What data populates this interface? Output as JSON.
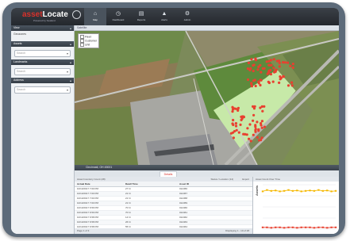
{
  "brand": {
    "name_prefix": "asset",
    "name": "Locate",
    "registered": "®",
    "sub": "Powered by Sealand"
  },
  "nav": [
    {
      "label": "Map",
      "icon": "map-icon",
      "glyph": "⌂"
    },
    {
      "label": "Dashboard",
      "icon": "dashboard-icon",
      "glyph": "◷"
    },
    {
      "label": "Reports",
      "icon": "reports-icon",
      "glyph": "▤"
    },
    {
      "label": "Alerts",
      "icon": "alerts-icon",
      "glyph": "▲"
    },
    {
      "label": "Admin",
      "icon": "admin-icon",
      "glyph": "⚙"
    }
  ],
  "sidebar": {
    "sections": [
      {
        "title": "View",
        "text": "Geozones",
        "input": ""
      },
      {
        "title": "Assets",
        "text": "",
        "input": "Search"
      },
      {
        "title": "Landmarks",
        "text": "",
        "input": "Search"
      },
      {
        "title": "Address",
        "text": "",
        "input": "Search"
      }
    ]
  },
  "map": {
    "header": "Satellite",
    "legend": [
      {
        "label": "Fleet",
        "color": "#ffffff"
      },
      {
        "label": "Customer",
        "color": "#ffffff"
      },
      {
        "label": "Unit",
        "color": "#ffffff"
      }
    ],
    "marker_color": "#e8402f",
    "zone_color": "#c7e9a8"
  },
  "address_bar": "Cincinnati, OH 45001",
  "tabs": {
    "active": "Details"
  },
  "table": {
    "title": "Asset Inventory Count (28)",
    "title_right": "Status / Location (14)",
    "title_export": "Export",
    "headers": [
      "Actual Date",
      "Dwell Time",
      "Asset ID"
    ],
    "rows": [
      [
        "10/13/2017 7:00 PM",
        "27 hr",
        "012456"
      ],
      [
        "10/13/2017 7:00 PM",
        "21 hr",
        "012457"
      ],
      [
        "10/13/2017 7:00 PM",
        "21 hr",
        "012458"
      ],
      [
        "10/13/2017 7:00 PM",
        "21 hr",
        "012459"
      ],
      [
        "10/13/2017 6:59 PM",
        "70 hr",
        "012460"
      ],
      [
        "10/13/2017 6:59 PM",
        "70 hr",
        "012461"
      ],
      [
        "10/13/2017 6:58 PM",
        "14 hr",
        "012462"
      ],
      [
        "10/13/2017 6:58 PM",
        "26 hr",
        "012463"
      ],
      [
        "10/13/2017 6:58 PM",
        "55 hr",
        "012464"
      ]
    ],
    "pager_left": "Page 1 of 3",
    "pager_right": "Displaying 1 - 10 of 28"
  },
  "chart_panel": {
    "title": "Asset Count Over Time",
    "chart_data": {
      "type": "line",
      "title": "",
      "xlabel": "",
      "ylabel": "Assets",
      "series": [
        {
          "name": "",
          "color": "#f5b800",
          "values": [
            85,
            88,
            86,
            87,
            85,
            86,
            88,
            86,
            87,
            85,
            86,
            87,
            86,
            88,
            86,
            87,
            85,
            86
          ]
        },
        {
          "name": "",
          "color": "#e8402f",
          "values": [
            4,
            4,
            3,
            4,
            4,
            3,
            4,
            4,
            3,
            4,
            4,
            4,
            3,
            4,
            4,
            3,
            4,
            4
          ]
        }
      ],
      "ylim": [
        0,
        100
      ],
      "grid": true
    }
  }
}
